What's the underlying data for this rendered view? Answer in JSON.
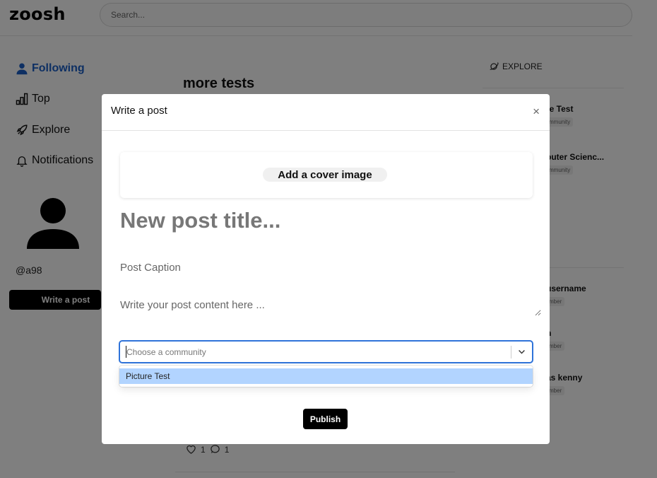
{
  "app": {
    "logo": "zoosh"
  },
  "search": {
    "placeholder": "Search..."
  },
  "nav": {
    "items": [
      {
        "label": "Following",
        "icon": "user-icon",
        "active": true
      },
      {
        "label": "Top",
        "icon": "bar-chart-icon"
      },
      {
        "label": "Explore",
        "icon": "rocket-icon"
      },
      {
        "label": "Notifications",
        "icon": "bell-icon"
      }
    ]
  },
  "profile": {
    "handle": "@a98",
    "write_button": "Write a post"
  },
  "feed": {
    "title": "more tests",
    "likes": "1",
    "comments": "1"
  },
  "right": {
    "explore_label": "EXPLORE",
    "communities": [
      {
        "name": "re Test",
        "badge": "mmunity"
      },
      {
        "name": "puter Scienc...",
        "badge": "mmunity"
      }
    ],
    "members": [
      {
        "name": "username",
        "badge": "mber"
      },
      {
        "name": "n",
        "badge": "mber"
      },
      {
        "name": "as kenny",
        "badge": "mber"
      }
    ]
  },
  "modal": {
    "title": "Write a post",
    "close": "×",
    "cover_button": "Add a cover image",
    "title_placeholder": "New post title...",
    "caption_placeholder": "Post Caption",
    "content_placeholder": "Write your post content here ...",
    "community_placeholder": "Choose a community",
    "community_options": [
      "Picture Test"
    ],
    "publish": "Publish"
  },
  "colors": {
    "active_nav": "#1a5fc7",
    "select_focus": "#2f73d9",
    "option_highlight": "#b2d4ff",
    "overlay": "rgba(0,0,0,0.5)"
  }
}
